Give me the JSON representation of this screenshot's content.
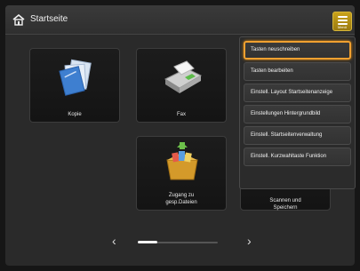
{
  "header": {
    "title": "Startseite",
    "menu_label": "Menü"
  },
  "tiles": [
    {
      "label": "Kopie",
      "icon": "copy-icon"
    },
    {
      "label": "Fax",
      "icon": "fax-icon"
    },
    {
      "label": "Zugang zu gesp.Dateien",
      "icon": "stored-files-icon"
    },
    {
      "label": "Scannen und Speichern",
      "icon": "scan-and-store-icon"
    }
  ],
  "menu": {
    "items": [
      {
        "label": "Tasten neuschreiben",
        "selected": true
      },
      {
        "label": "Tasten bearbeiten",
        "selected": false
      },
      {
        "label": "Einstell. Layout Startseitenanzeige",
        "selected": false
      },
      {
        "label": "Einstellungen Hintergrundbild",
        "selected": false
      },
      {
        "label": "Einstell. Startseitenverwaltung",
        "selected": false
      },
      {
        "label": "Einstell. Kurzwahltaste Funktion",
        "selected": false
      }
    ]
  },
  "pager": {
    "prev": "‹",
    "next": "›"
  },
  "colors": {
    "menu_button": "#c9a21a",
    "selection_outline": "#f0a030"
  }
}
